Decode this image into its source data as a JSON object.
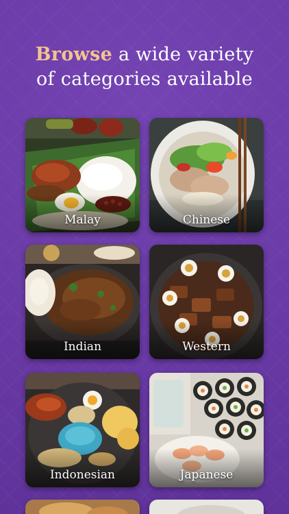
{
  "headline": {
    "accent": "Browse",
    "rest_line1": " a wide variety",
    "line2": "of categories available"
  },
  "categories": [
    {
      "label": "Malay"
    },
    {
      "label": "Chinese"
    },
    {
      "label": "Indian"
    },
    {
      "label": "Western"
    },
    {
      "label": "Indonesian"
    },
    {
      "label": "Japanese"
    }
  ],
  "colors": {
    "background": "#6a3aa6",
    "accent": "#f3c48e",
    "text": "#ffffff"
  }
}
